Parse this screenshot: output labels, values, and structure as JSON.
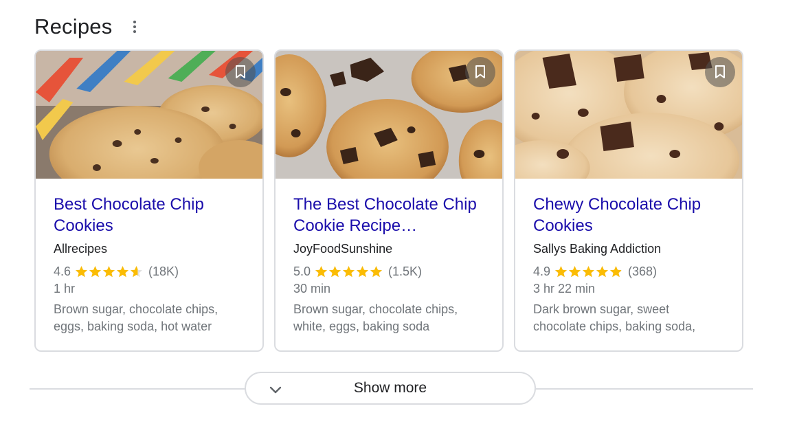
{
  "section": {
    "title": "Recipes",
    "menu_icon": "more-vert-icon"
  },
  "cards": [
    {
      "title": "Best Chocolate Chip Cookies",
      "source": "Allrecipes",
      "rating": "4.6",
      "rating_value": 4.6,
      "reviews": "(18K)",
      "time": "1 hr",
      "ingredients": "Brown sugar, chocolate chips, eggs, baking soda, hot water",
      "bookmark_icon": "bookmark-icon"
    },
    {
      "title": "The Best Chocolate Chip Cookie Recipe…",
      "source": "JoyFoodSunshine",
      "rating": "5.0",
      "rating_value": 5.0,
      "reviews": "(1.5K)",
      "time": "30 min",
      "ingredients": "Brown sugar, chocolate chips, white, eggs, baking soda",
      "bookmark_icon": "bookmark-icon"
    },
    {
      "title": "Chewy Chocolate Chip Cookies",
      "source": "Sallys Baking Addiction",
      "rating": "4.9",
      "rating_value": 4.9,
      "reviews": "(368)",
      "time": "3 hr 22 min",
      "ingredients": "Dark brown sugar, sweet chocolate chips, baking soda,",
      "bookmark_icon": "bookmark-icon"
    }
  ],
  "show_more": {
    "label": "Show more",
    "icon": "chevron-down-icon"
  },
  "colors": {
    "link": "#1a0dab",
    "star": "#fbbc04",
    "muted": "#70757a",
    "border": "#dadce0"
  }
}
